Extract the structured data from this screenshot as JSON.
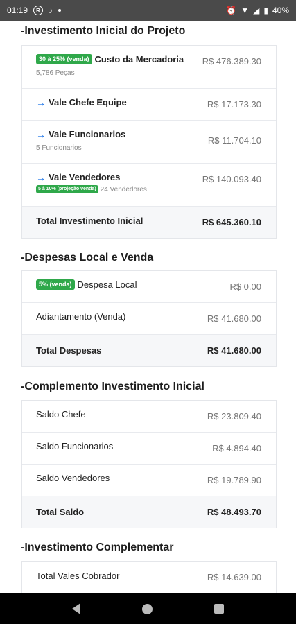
{
  "status": {
    "time": "01:19",
    "notif_icon": "r-icon",
    "battery": "40%"
  },
  "sections": {
    "inicial": {
      "title": "-Investimento Inicial do Projeto",
      "rows": [
        {
          "badge": "30 à 25% (venda)",
          "label": "Custo da Mercadoria",
          "sub": "5,786 Peças",
          "value": "R$ 476.389.30"
        },
        {
          "label": "Vale Chefe Equipe",
          "value": "R$ 17.173.30"
        },
        {
          "label": "Vale Funcionarios",
          "sub": "5 Funcionarios",
          "value": "R$ 11.704.10"
        },
        {
          "label": "Vale Vendedores",
          "sub_badge": "5 à 10% (projeção venda)",
          "sub": "24 Vendedores",
          "value": "R$ 140.093.40"
        },
        {
          "label": "Total Investimento Inicial",
          "value": "R$ 645.360.10"
        }
      ]
    },
    "despesas": {
      "title": "-Despesas Local e Venda",
      "rows": [
        {
          "badge": "5% (venda)",
          "label": "Despesa Local",
          "value": "R$ 0.00"
        },
        {
          "label": "Adiantamento (Venda)",
          "value": "R$ 41.680.00"
        },
        {
          "label": "Total Despesas",
          "value": "R$ 41.680.00"
        }
      ]
    },
    "complemento": {
      "title": "-Complemento Investimento Inicial",
      "rows": [
        {
          "label": "Saldo Chefe",
          "value": "R$ 23.809.40"
        },
        {
          "label": "Saldo Funcionarios",
          "value": "R$ 4.894.40"
        },
        {
          "label": "Saldo Vendedores",
          "value": "R$ 19.789.90"
        },
        {
          "label": "Total Saldo",
          "value": "R$ 48.493.70"
        }
      ]
    },
    "complementar": {
      "title": "-Investimento Complementar",
      "rows": [
        {
          "label": "Total Vales Cobrador",
          "value": "R$ 14.639.00"
        }
      ]
    }
  },
  "icons": {
    "arrow": "→"
  },
  "colors": {
    "badge_green": "#2fa84a",
    "arrow_blue": "#1a73e8",
    "status_bar": "#4a4a4a"
  }
}
